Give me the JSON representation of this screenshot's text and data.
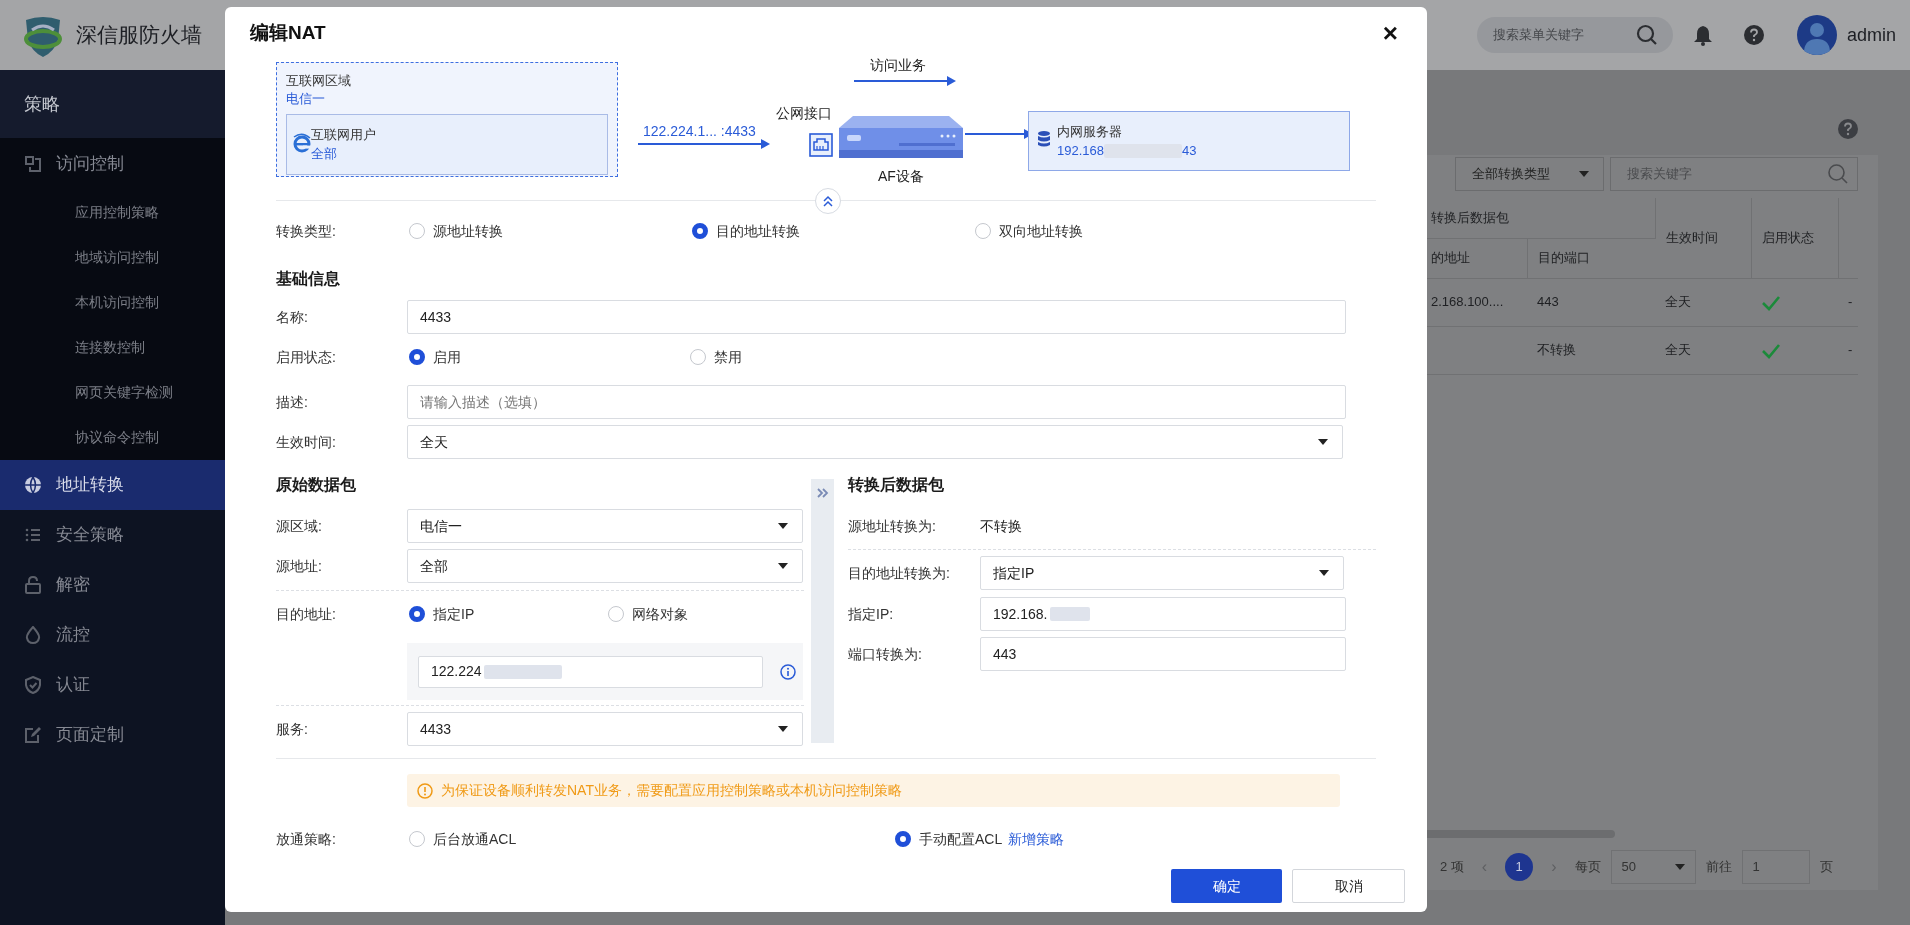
{
  "header": {
    "brand": "深信服防火墙",
    "search": {
      "placeholder": "搜索菜单关键字"
    },
    "user": "admin"
  },
  "sidebar": {
    "section": "策略",
    "items": [
      {
        "label": "访问控制",
        "selected": false,
        "expanded": true,
        "children": [
          {
            "label": "应用控制策略",
            "selected": false
          },
          {
            "label": "地域访问控制",
            "selected": false
          },
          {
            "label": "本机访问控制",
            "selected": false
          },
          {
            "label": "连接数控制",
            "selected": false
          },
          {
            "label": "网页关键字检测",
            "selected": false
          },
          {
            "label": "协议命令控制",
            "selected": false
          }
        ]
      },
      {
        "label": "地址转换",
        "selected": true
      },
      {
        "label": "安全策略",
        "selected": false
      },
      {
        "label": "解密",
        "selected": false
      },
      {
        "label": "流控",
        "selected": false
      },
      {
        "label": "认证",
        "selected": false
      },
      {
        "label": "页面定制",
        "selected": false
      }
    ]
  },
  "page": {
    "type_filter": "全部转换类型",
    "search": {
      "placeholder": "搜索关键字"
    },
    "table": {
      "group_header": "转换后数据包",
      "columns": [
        "的地址",
        "目的端口",
        "生效时间",
        "启用状态"
      ],
      "rows": [
        {
          "dest_address": "2.168.100....",
          "dest_port": "443",
          "effective_time": "全天",
          "enabled": true,
          "column_5": "-"
        },
        {
          "dest_port": "不转换",
          "effective_time": "全天",
          "enabled": true,
          "column_5": "-"
        }
      ]
    },
    "pagination": {
      "total": "2 项",
      "prev": "‹",
      "page": "1",
      "next": "›",
      "per_page_label": "每页",
      "per_page": "50",
      "goto_label": "前往",
      "goto_page": "1",
      "page_suffix": "页"
    }
  },
  "dialog": {
    "title": "编辑NAT",
    "close": "×",
    "diagram": {
      "zone_label": "互联网区域",
      "zone": "电信一",
      "source_label": "互联网用户",
      "source": "全部",
      "source_address": "122.224.1... :4433",
      "service_label": "访问业务",
      "interface_label": "公网接口",
      "device_label": "AF设备",
      "server_label": "内网服务器",
      "server_ip_start": "192.168",
      "server_ip_end": "43"
    },
    "conversion_type": {
      "label": "转换类型:",
      "options": [
        {
          "label": "源地址转换",
          "selected": false
        },
        {
          "label": "目的地址转换",
          "selected": true
        },
        {
          "label": "双向地址转换",
          "selected": false
        }
      ]
    },
    "basic": {
      "heading": "基础信息",
      "name": {
        "label": "名称:",
        "value": "4433"
      },
      "status": {
        "label": "启用状态:",
        "options": [
          {
            "label": "启用",
            "selected": true
          },
          {
            "label": "禁用",
            "selected": false
          }
        ]
      },
      "description": {
        "label": "描述:",
        "placeholder": "请输入描述（选填）"
      },
      "schedule": {
        "label": "生效时间:",
        "value": "全天"
      }
    },
    "original": {
      "heading": "原始数据包",
      "source_zone": {
        "label": "源区域:",
        "value": "电信一"
      },
      "source_address": {
        "label": "源地址:",
        "value": "全部"
      },
      "dest_address": {
        "label": "目的地址:",
        "options": [
          {
            "label": "指定IP",
            "selected": true
          },
          {
            "label": "网络对象",
            "selected": false
          }
        ],
        "ip_value": "122.224"
      },
      "service": {
        "label": "服务:",
        "value": "4433"
      }
    },
    "translated": {
      "heading": "转换后数据包",
      "source_translation": {
        "label": "源地址转换为:",
        "value": "不转换"
      },
      "dest_translation": {
        "label": "目的地址转换为:",
        "value": "指定IP"
      },
      "ip": {
        "label": "指定IP:",
        "value": "192.168."
      },
      "port": {
        "label": "端口转换为:",
        "value": "443"
      }
    },
    "notice": "为保证设备顺利转发NAT业务，需要配置应用控制策略或本机访问控制策略",
    "acl_policy": {
      "label": "放通策略:",
      "options": [
        {
          "label": "后台放通ACL",
          "selected": false
        },
        {
          "label": "手动配置ACL",
          "selected": true
        }
      ],
      "link": "新增策略"
    },
    "buttons": [
      {
        "label": "确定",
        "kind": "primary"
      },
      {
        "label": "取消",
        "kind": "secondary"
      }
    ]
  }
}
